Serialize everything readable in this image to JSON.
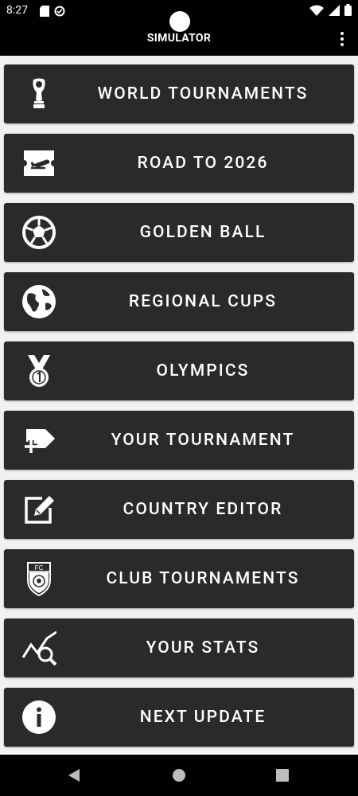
{
  "status_bar": {
    "time": "8:27"
  },
  "app_bar": {
    "title": "SIMULATOR"
  },
  "menu": {
    "items": [
      {
        "label": "WORLD TOURNAMENTS",
        "icon": "trophy-icon"
      },
      {
        "label": "ROAD TO 2026",
        "icon": "flight-ticket-icon"
      },
      {
        "label": "GOLDEN BALL",
        "icon": "soccer-ball-icon"
      },
      {
        "label": "REGIONAL CUPS",
        "icon": "globe-icon"
      },
      {
        "label": "OLYMPICS",
        "icon": "medal-icon"
      },
      {
        "label": "YOUR TOURNAMENT",
        "icon": "add-tag-icon"
      },
      {
        "label": "COUNTRY EDITOR",
        "icon": "edit-icon"
      },
      {
        "label": "CLUB TOURNAMENTS",
        "icon": "club-crest-icon",
        "crest_text": "FC"
      },
      {
        "label": "YOUR STATS",
        "icon": "stats-search-icon"
      },
      {
        "label": "NEXT UPDATE",
        "icon": "info-icon"
      }
    ]
  },
  "colors": {
    "button_bg": "#2a2a2a",
    "bar_bg": "#000000",
    "page_bg": "#f1f1f1",
    "text": "#ffffff"
  }
}
